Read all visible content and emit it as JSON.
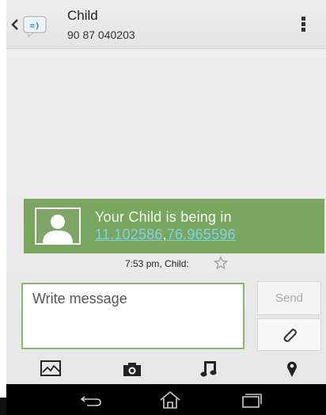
{
  "header": {
    "title": "Child",
    "phone": "90 87 040203",
    "app_icon_text": "=)"
  },
  "message": {
    "line1": "Your Child is being in",
    "coord_lat": "11.102586",
    "coord_sep": ",",
    "coord_lon": "76.965596",
    "timestamp": "7:53 pm, Child:",
    "bubble_color": "#79a760",
    "link_color": "#7fd1ea"
  },
  "compose": {
    "placeholder": "Write message",
    "send_label": "Send"
  },
  "toolbar": {
    "items": [
      "picture-icon",
      "camera-icon",
      "music-note-icon",
      "location-pin-icon"
    ]
  },
  "navbar": {
    "items": [
      "back-icon",
      "home-icon",
      "recent-apps-icon"
    ]
  }
}
